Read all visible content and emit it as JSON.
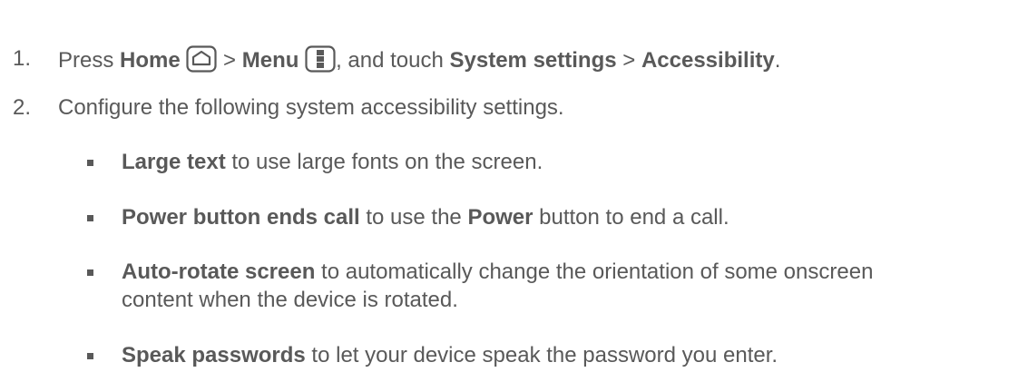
{
  "steps": [
    {
      "number": "1.",
      "parts": {
        "press": "Press ",
        "home": "Home",
        "sep1": " > ",
        "menu": "Menu",
        "after_menu": ", and touch ",
        "system_settings": "System settings",
        "sep2": " > ",
        "accessibility": "Accessibility",
        "end": "."
      },
      "icons": [
        "home-icon",
        "menu-icon"
      ]
    },
    {
      "number": "2.",
      "text": "Configure the following system accessibility settings."
    }
  ],
  "options": [
    {
      "bold": "Large text",
      "text": " to use large fonts on the screen."
    },
    {
      "bold": "Power button ends call",
      "text_before": " to use the ",
      "bold2": "Power",
      "text_after": " button to end a call."
    },
    {
      "bold": "Auto-rotate screen",
      "text": " to automatically change the orientation of some onscreen",
      "text_line2": "content when the device is rotated."
    },
    {
      "bold": "Speak passwords",
      "text": " to let your device speak the password you enter."
    }
  ]
}
